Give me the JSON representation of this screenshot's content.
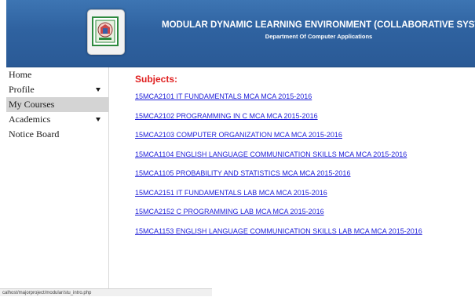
{
  "header": {
    "title": "MODULAR DYNAMIC LEARNING ENVIRONMENT (COLLABORATIVE SYSTEM)",
    "subtitle": "Department Of Computer Applications",
    "logo_icon": "institution-seal-icon",
    "colors": {
      "banner": "#2f62a0",
      "text": "#ffffff"
    }
  },
  "sidebar": {
    "items": [
      {
        "label": "Home",
        "has_dropdown": false,
        "active": false
      },
      {
        "label": "Profile",
        "has_dropdown": true,
        "active": false
      },
      {
        "label": "My Courses",
        "has_dropdown": false,
        "active": true
      },
      {
        "label": "Academics",
        "has_dropdown": true,
        "active": false
      },
      {
        "label": "Notice Board",
        "has_dropdown": false,
        "active": false
      }
    ]
  },
  "main": {
    "heading": "Subjects:",
    "heading_color": "#e02020",
    "link_color": "#1f1fd8",
    "courses": [
      "15MCA2101 IT FUNDAMENTALS MCA MCA 2015-2016",
      "15MCA2102 PROGRAMMING IN C MCA MCA 2015-2016",
      "15MCA2103 COMPUTER ORGANIZATION MCA MCA 2015-2016",
      "15MCA1104 ENGLISH LANGUAGE COMMUNICATION SKILLS MCA MCA 2015-2016",
      "15MCA1105 PROBABILITY AND STATISTICS MCA MCA 2015-2016",
      "15MCA2151 IT FUNDAMENTALS LAB MCA MCA 2015-2016",
      "15MCA2152 C PROGRAMMING LAB MCA MCA 2015-2016",
      "15MCA1153 ENGLISH LANGUAGE COMMUNICATION SKILLS LAB MCA MCA 2015-2016"
    ]
  },
  "statusbar": {
    "url": "calhost/majorproject/modular/stu_intro.php"
  }
}
